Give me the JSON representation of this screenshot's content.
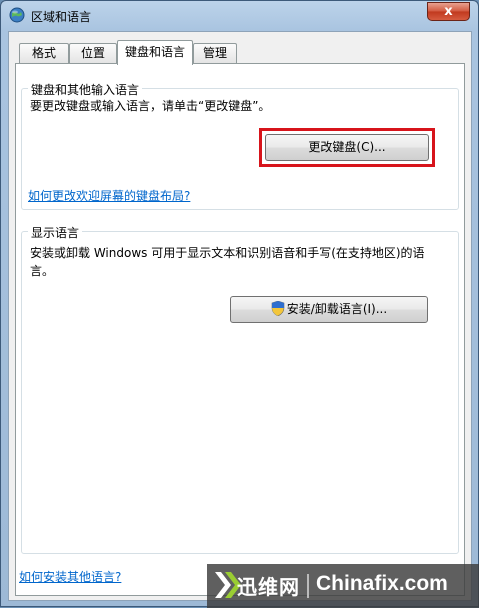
{
  "window": {
    "title": "区域和语言",
    "close_label": "x"
  },
  "tabs": [
    {
      "label": "格式"
    },
    {
      "label": "位置"
    },
    {
      "label": "键盘和语言",
      "active": true
    },
    {
      "label": "管理"
    }
  ],
  "keyboard_group": {
    "title": "键盘和其他输入语言",
    "description": "要更改键盘或输入语言，请单击“更改键盘”。",
    "change_button": "更改键盘(C)...",
    "welcome_link": "如何更改欢迎屏幕的键盘布局?"
  },
  "display_group": {
    "title": "显示语言",
    "description_line1": "安装或卸载 Windows 可用于显示文本和识别语音和手写(在支持地区)的语",
    "description_line2": "言。",
    "install_button": "安装/卸载语言(I)..."
  },
  "bottom_link": "如何安装其他语言?",
  "watermark": {
    "cn": "迅维网",
    "en": "Chinafix.com"
  },
  "colors": {
    "highlight": "#d7141b",
    "link": "#0066cc"
  }
}
